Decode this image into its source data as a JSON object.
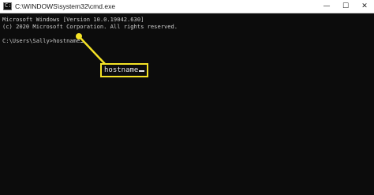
{
  "window": {
    "title": "C:\\WINDOWS\\system32\\cmd.exe",
    "icon": "cmd-icon",
    "icon_glyph": "C:\\",
    "minimize_glyph": "—",
    "maximize_glyph": "☐",
    "close_glyph": "✕"
  },
  "console": {
    "lines": [
      "Microsoft Windows [Version 10.0.19042.630]",
      "(c) 2020 Microsoft Corporation. All rights reserved."
    ],
    "prompt": "C:\\Users\\Sally>",
    "command": "hostname"
  },
  "callout": {
    "text": "hostname",
    "color": "#f5e326"
  }
}
